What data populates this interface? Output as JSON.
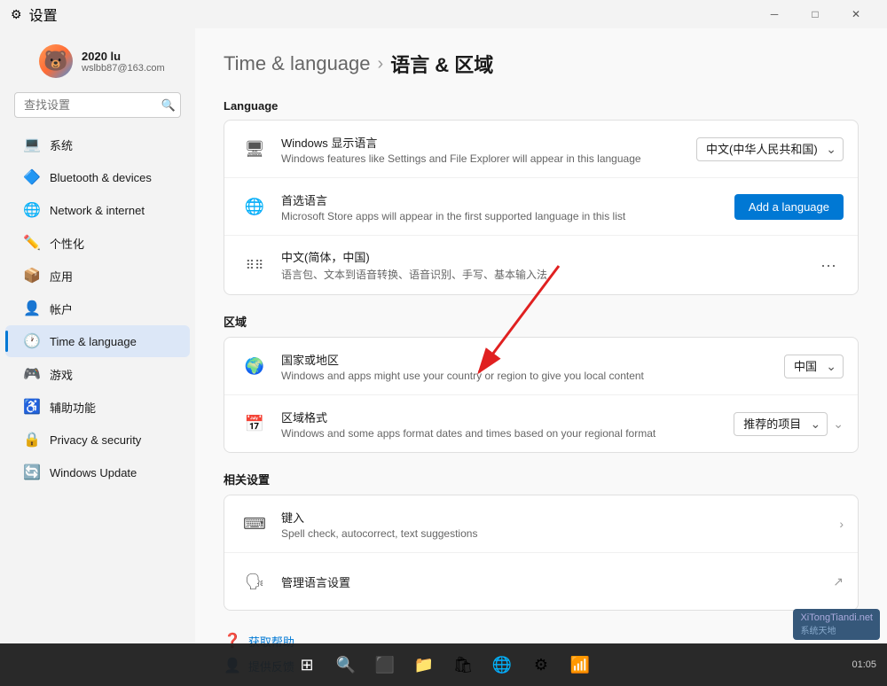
{
  "titlebar": {
    "title": "设置",
    "back_label": "←"
  },
  "user": {
    "name": "2020 lu",
    "email": "wslbb87@163.com"
  },
  "search": {
    "placeholder": "查找设置"
  },
  "nav": {
    "items": [
      {
        "id": "system",
        "label": "系统",
        "icon": "💻",
        "icon_class": "blue"
      },
      {
        "id": "bluetooth",
        "label": "Bluetooth & devices",
        "icon": "🔷",
        "icon_class": "blue"
      },
      {
        "id": "network",
        "label": "Network & internet",
        "icon": "🌐",
        "icon_class": "teal"
      },
      {
        "id": "personalize",
        "label": "个性化",
        "icon": "✏️",
        "icon_class": "orange"
      },
      {
        "id": "apps",
        "label": "应用",
        "icon": "📦",
        "icon_class": "orange"
      },
      {
        "id": "accounts",
        "label": "帐户",
        "icon": "👤",
        "icon_class": "blue"
      },
      {
        "id": "time",
        "label": "Time & language",
        "icon": "🕐",
        "icon_class": "blue",
        "active": true
      },
      {
        "id": "gaming",
        "label": "游戏",
        "icon": "🎮",
        "icon_class": "green"
      },
      {
        "id": "accessibility",
        "label": "辅助功能",
        "icon": "♿",
        "icon_class": "blue"
      },
      {
        "id": "privacy",
        "label": "Privacy & security",
        "icon": "🔒",
        "icon_class": "yellow"
      },
      {
        "id": "update",
        "label": "Windows Update",
        "icon": "🔄",
        "icon_class": "blue"
      }
    ]
  },
  "page": {
    "breadcrumb_parent": "Time & language",
    "breadcrumb_sep": "›",
    "breadcrumb_current": "语言 & 区域"
  },
  "sections": {
    "language": {
      "title": "Language",
      "rows": [
        {
          "id": "display-lang",
          "icon": "🖥",
          "title": "Windows 显示语言",
          "subtitle": "Windows features like Settings and File Explorer will appear in this language",
          "action_type": "select",
          "action_value": "中文(中华人民共和国)"
        },
        {
          "id": "preferred-lang",
          "icon": "🌐",
          "title": "首选语言",
          "subtitle": "Microsoft Store apps will appear in the first supported language in this list",
          "action_type": "button",
          "action_value": "Add a language"
        },
        {
          "id": "chinese-lang",
          "icon": "⠿",
          "title": "中文(简体，中国)",
          "subtitle": "语言包、文本到语音转换、语音识别、手写、基本输入法",
          "action_type": "dots"
        }
      ]
    },
    "region": {
      "title": "区域",
      "rows": [
        {
          "id": "country",
          "icon": "🌍",
          "title": "国家或地区",
          "subtitle": "Windows and apps might use your country or region to give you local content",
          "action_type": "select",
          "action_value": "中国"
        },
        {
          "id": "regional-format",
          "icon": "📅",
          "title": "区域格式",
          "subtitle": "Windows and some apps format dates and times based on your regional format",
          "action_type": "select_chevron",
          "action_value": "推荐的项目"
        }
      ]
    },
    "related": {
      "title": "相关设置",
      "rows": [
        {
          "id": "typing",
          "icon": "⌨",
          "title": "键入",
          "subtitle": "Spell check, autocorrect, text suggestions",
          "action_type": "chevron"
        },
        {
          "id": "lang-settings",
          "icon": "🗣",
          "title": "管理语言设置",
          "subtitle": "",
          "action_type": "external"
        }
      ]
    }
  },
  "help": {
    "links": [
      {
        "id": "get-help",
        "icon": "❓",
        "label": "获取帮助"
      },
      {
        "id": "feedback",
        "icon": "👤",
        "label": "提供反馈"
      }
    ]
  },
  "taskbar": {
    "items": [
      {
        "id": "start",
        "icon": "⊞"
      },
      {
        "id": "search",
        "icon": "🔍"
      },
      {
        "id": "taskview",
        "icon": "⬜"
      },
      {
        "id": "files",
        "icon": "📁"
      },
      {
        "id": "store",
        "icon": "🛍"
      },
      {
        "id": "chrome",
        "icon": "🌐"
      },
      {
        "id": "settings2",
        "icon": "⚙"
      },
      {
        "id": "network2",
        "icon": "📶"
      }
    ]
  },
  "watermark": {
    "text": "XiTongTiandi.net",
    "subtext": "系统天地"
  }
}
